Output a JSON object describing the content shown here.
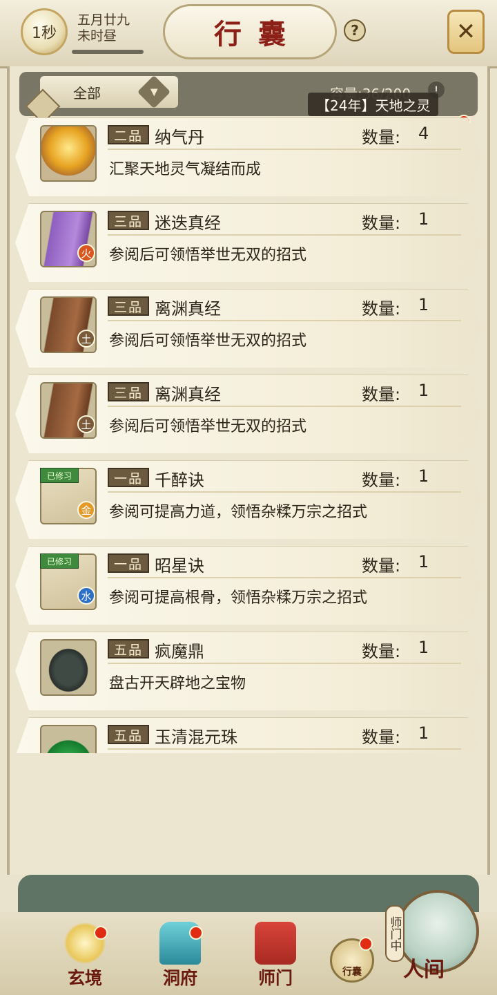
{
  "header": {
    "clock": "1秒",
    "date_line1": "五月廿九",
    "date_line2": "未时昼",
    "title": "行囊",
    "help": "?"
  },
  "filter": {
    "selected": "全部",
    "capacity": "容量:36/200",
    "warn": "!",
    "tooltip": "【24年】天地之灵"
  },
  "items": [
    {
      "grade": "二品",
      "name": "纳气丹",
      "qty_label": "数量:",
      "qty": "4",
      "desc": "汇聚天地灵气凝结而成",
      "icon": "golden-orb-pill",
      "element": "",
      "learned": ""
    },
    {
      "grade": "三品",
      "name": "迷迭真经",
      "qty_label": "数量:",
      "qty": "1",
      "desc": "参阅后可领悟举世无双的招式",
      "icon": "purple-book",
      "element": "火",
      "learned": ""
    },
    {
      "grade": "三品",
      "name": "离渊真经",
      "qty_label": "数量:",
      "qty": "1",
      "desc": "参阅后可领悟举世无双的招式",
      "icon": "brown-book",
      "element": "土",
      "learned": ""
    },
    {
      "grade": "三品",
      "name": "离渊真经",
      "qty_label": "数量:",
      "qty": "1",
      "desc": "参阅后可领悟举世无双的招式",
      "icon": "brown-book",
      "element": "土",
      "learned": ""
    },
    {
      "grade": "一品",
      "name": "千醉诀",
      "qty_label": "数量:",
      "qty": "1",
      "desc": "参阅可提高力道，领悟杂糅万宗之招式",
      "icon": "scroll",
      "element": "金",
      "learned": "已修习"
    },
    {
      "grade": "一品",
      "name": "昭星诀",
      "qty_label": "数量:",
      "qty": "1",
      "desc": "参阅可提高根骨，领悟杂糅万宗之招式",
      "icon": "scroll",
      "element": "水",
      "learned": "已修习"
    },
    {
      "grade": "五品",
      "name": "疯魔鼎",
      "qty_label": "数量:",
      "qty": "1",
      "desc": "盘古开天辟地之宝物",
      "icon": "bronze-cauldron",
      "element": "",
      "learned": ""
    },
    {
      "grade": "五品",
      "name": "玉清混元珠",
      "qty_label": "数量:",
      "qty": "1",
      "desc": "",
      "icon": "jade-orb",
      "element": "",
      "learned": ""
    }
  ],
  "nav": {
    "xuanjing": "玄境",
    "dongfu": "洞府",
    "shimen": "师门",
    "bag": "行囊",
    "master_status": "师门中",
    "world": "人间"
  },
  "colors": {
    "accent_red": "#8c1f16",
    "notify_red": "#e02c13",
    "panel_green": "#5f7465",
    "parchment": "#f4eed9"
  }
}
